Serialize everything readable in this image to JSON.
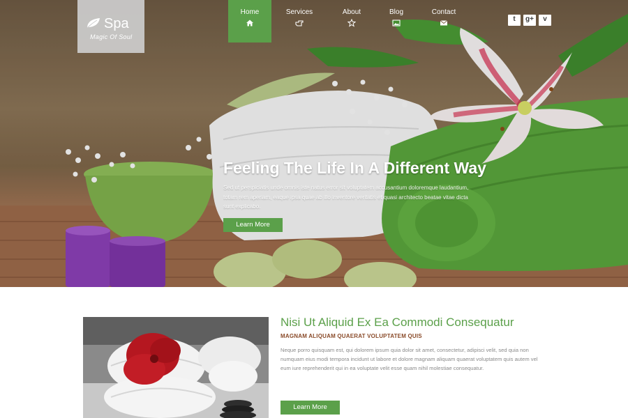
{
  "logo": {
    "name": "Spa",
    "tagline": "Magic Of Soul",
    "icon": "leaf-icon"
  },
  "nav": {
    "items": [
      {
        "label": "Home",
        "icon": "home-icon",
        "active": true
      },
      {
        "label": "Services",
        "icon": "hand-icon",
        "active": false
      },
      {
        "label": "About",
        "icon": "star-icon",
        "active": false
      },
      {
        "label": "Blog",
        "icon": "image-icon",
        "active": false
      },
      {
        "label": "Contact",
        "icon": "envelope-icon",
        "active": false
      }
    ]
  },
  "social": {
    "twitter": "t",
    "googleplus": "g+",
    "vimeo": "v"
  },
  "hero": {
    "title": "Feeling The Life In A Different Way",
    "text": "Sed ut perspiciatis unde omnis iste natus error sit voluptatem accusantium doloremque laudantium, totam rem aperiam, eaque ipsa quae ab illo inventore veritatis et quasi architecto beatae vitae dicta sunt explicabo.",
    "button": "Learn More"
  },
  "content": {
    "title": "Nisi Ut Aliquid Ex Ea Commodi Consequatur",
    "subtitle": "MAGNAM ALIQUAM QUAERAT VOLUPTATEM QUIS",
    "text": "Neque porro quisquam est, qui dolorem ipsum quia dolor sit amet, consectetur, adipisci velit, sed quia non numquam eius modi tempora incidunt ut labore et dolore magnam aliquam quaerat voluptatem quis autem vel eum iure reprehenderit qui in ea voluptate velit esse quam nihil molestiae consequatur.",
    "button": "Learn More"
  },
  "colors": {
    "accent": "#5ba04a",
    "subtitle": "#8a4b2a",
    "body_text": "#8a8a8a"
  }
}
